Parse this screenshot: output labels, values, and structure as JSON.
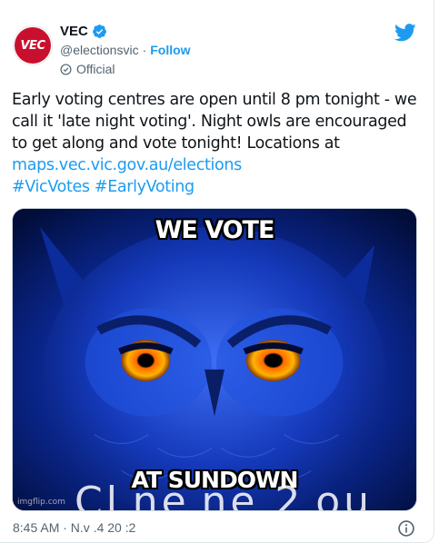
{
  "tweet": {
    "author": {
      "name": "VEC",
      "handle": "@electionsvic",
      "separator": "·",
      "follow_label": "Follow",
      "badge_label": "Official",
      "avatar_text": "VEC"
    },
    "text_segments": [
      "Early voting centres are open until 8 pm tonight - we call it 'late night voting'. Night owls are encouraged to get along and vote tonight! Locations at ",
      "maps.vec.vic.gov.au/elections",
      "#VicVotes",
      "#EarlyVoting"
    ],
    "media": {
      "top_caption": "WE VOTE",
      "bottom_caption": "AT SUNDOWN",
      "watermark": "imgflip.com",
      "overlay_text": "Cl ne ne 2 ou"
    },
    "timestamp": "8:45 AM · N.v  .4  20 :2"
  },
  "colors": {
    "accent": "#1d9bf0",
    "brand": "#c8102e",
    "text": "#0f1419",
    "muted": "#536471",
    "owl_blue": "#0a2fb8",
    "owl_eye": "#ff9a00"
  },
  "icons": {
    "verified": "verified-badge-icon",
    "official": "official-check-icon",
    "platform": "twitter-bird-icon",
    "info": "info-icon"
  }
}
